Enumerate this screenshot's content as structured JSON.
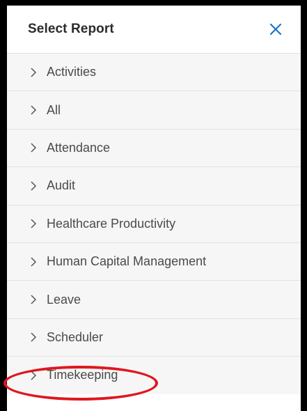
{
  "panel": {
    "title": "Select Report",
    "close_icon": "close-icon",
    "accent_color": "#1a73c7"
  },
  "reports": [
    {
      "label": "Activities"
    },
    {
      "label": "All"
    },
    {
      "label": "Attendance"
    },
    {
      "label": "Audit"
    },
    {
      "label": "Healthcare Productivity"
    },
    {
      "label": "Human Capital Management"
    },
    {
      "label": "Leave"
    },
    {
      "label": "Scheduler"
    },
    {
      "label": "Timekeeping"
    }
  ],
  "annotation": {
    "highlight_color": "#e0161f",
    "highlighted_item": "Timekeeping"
  }
}
